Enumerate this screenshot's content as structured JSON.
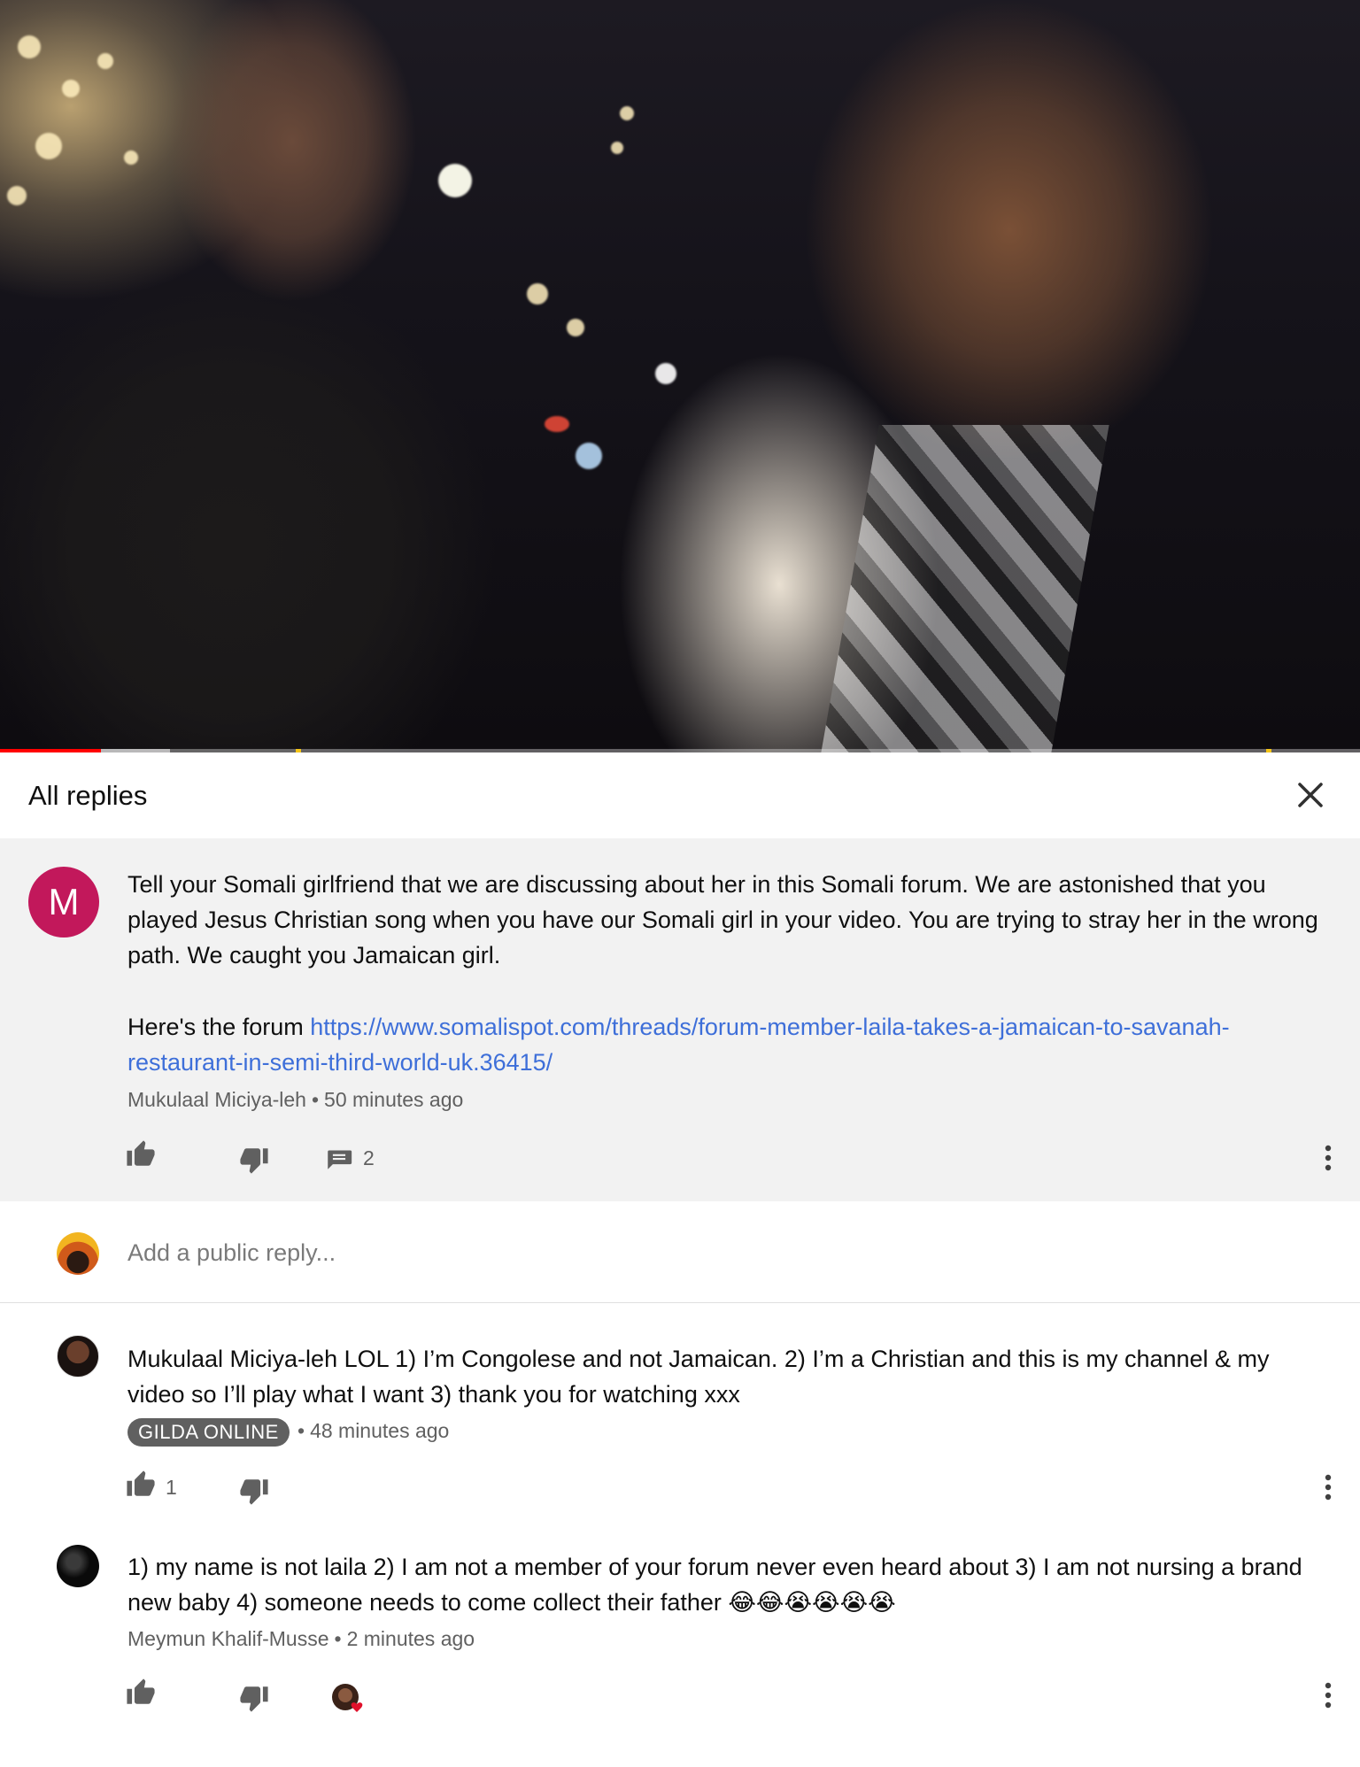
{
  "video": {
    "progress_played_fraction": 0.074,
    "progress_buffered_fraction": 0.125,
    "colors": {
      "played": "#ff0000",
      "ad_marker": "#f5c518"
    }
  },
  "panel": {
    "title": "All replies",
    "close_icon": "close-icon"
  },
  "parent_comment": {
    "avatar_letter": "M",
    "avatar_color": "#c2185b",
    "text_line1": "Tell your Somali girlfriend that we are discussing about her in this Somali forum. We are astonished that you played Jesus Christian song when you have our Somali girl in your video. You are trying to stray her in the wrong path. We caught you Jamaican girl.",
    "text_prefix": "Here's the forum ",
    "link": "https://www.somalispot.com/threads/forum-member-laila-takes-a-jamaican-to-savanah-restaurant-in-semi-third-world-uk.36415/",
    "author": "Mukulaal Miciya-leh",
    "time": "50 minutes ago",
    "reply_count": "2",
    "separator": "•"
  },
  "reply_box": {
    "placeholder": "Add a public reply..."
  },
  "replies": [
    {
      "text": "Mukulaal Miciya-leh LOL 1) I’m Congolese and not Jamaican. 2) I’m a Christian and this is my channel & my video so I’ll play what I want 3) thank you for watching xxx",
      "author_badge": "GILDA ONLINE",
      "time": "48 minutes ago",
      "like_count": "1"
    },
    {
      "text": "1) my name is not laila 2) I am not a member of your forum never even heard about 3) I am not nursing a brand new baby 4) someone needs to come collect their father ",
      "emojis": "😂😂😭😭😭😭",
      "author": "Meymun Khalif-Musse",
      "time": "2 minutes ago"
    }
  ]
}
